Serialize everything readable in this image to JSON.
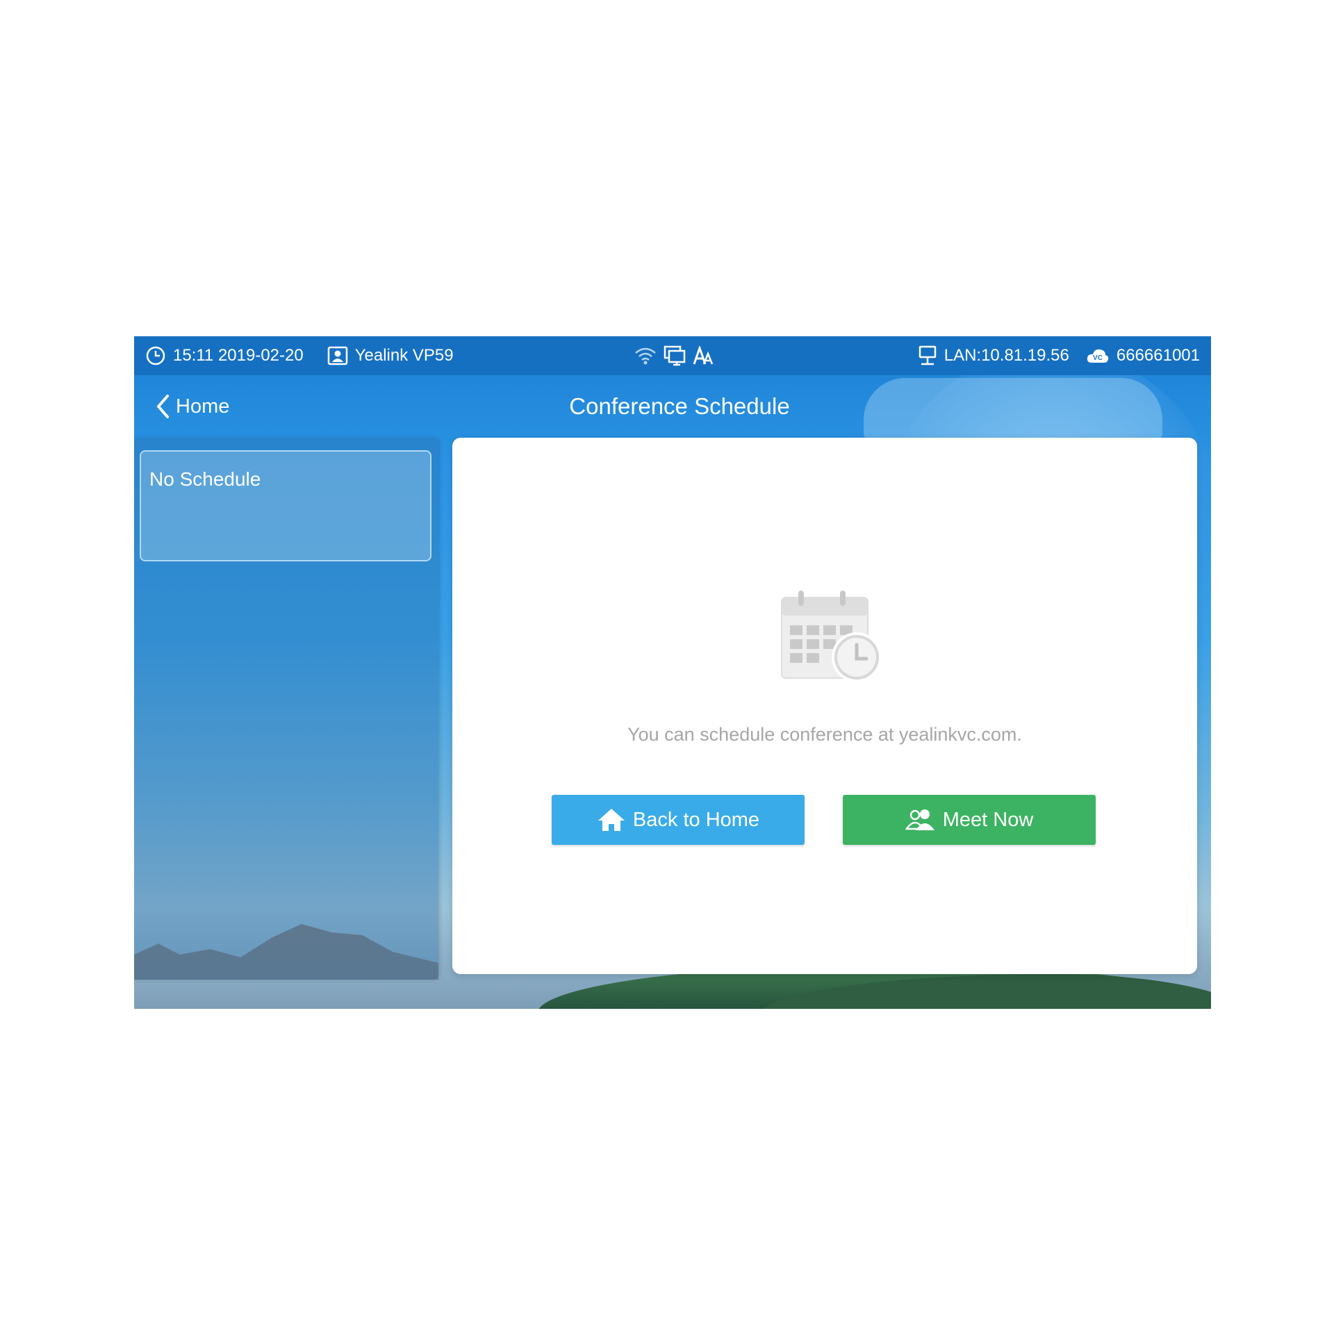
{
  "statusbar": {
    "time_date": "15:11 2019-02-20",
    "device_name": "Yealink VP59",
    "lan": "LAN:10.81.19.56",
    "account": "666661001",
    "icons": [
      "clock-icon",
      "contact-icon",
      "wifi-icon",
      "screen-share-icon",
      "font-size-icon",
      "network-icon",
      "cloud-vc-icon"
    ]
  },
  "nav": {
    "back_label": "Home",
    "title": "Conference Schedule"
  },
  "sidebar": {
    "items": [
      {
        "label": "No Schedule"
      }
    ]
  },
  "main": {
    "icon": "calendar-clock-icon",
    "hint": "You can schedule conference at yealinkvc.com.",
    "back_home_label": "Back to Home",
    "meet_now_label": "Meet Now"
  },
  "colors": {
    "statusbar": "#1670c2",
    "back_home_button": "#3aabe9",
    "meet_now_button": "#3cb362",
    "hint_text": "#a6a6a6"
  }
}
